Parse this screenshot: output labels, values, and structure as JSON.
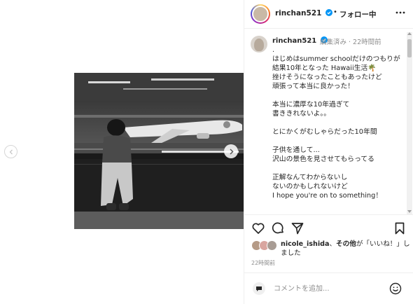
{
  "header": {
    "username": "rinchan521",
    "separator": "•",
    "follow_state": "フォロー中"
  },
  "caption": {
    "username": "rinchan521",
    "meta": "編集済み · 22時間前",
    "text": ".\nはじめはsummer schoolだけのつもりが\n結果10年となった Hawaii生活🌴\n挫けそうになったこともあったけど\n頑張って本当に良かった！\n\n本当に濃厚な10年過ぎて\n書ききれないよ。。\n\nとにかくがむしゃらだった10年間\n\n子供を通して...\n沢山の景色を見させてもらってる\n\n正解なんてわからないし\nないのかもしれないけど\nI hope you're on to something！"
  },
  "likes": {
    "user": "nicole_ishida",
    "connector": "、",
    "others": "その他",
    "suffix": "が「いいね！」しました"
  },
  "time_ago": "22時間前",
  "comment": {
    "placeholder": "コメントを追加..."
  },
  "icons": [
    "chevron-left-icon",
    "chevron-right-icon",
    "verified-badge-icon",
    "more-options-icon",
    "heart-icon",
    "comment-icon",
    "share-icon",
    "bookmark-icon",
    "emoji-icon"
  ],
  "colors": {
    "text": "#262626",
    "muted": "#8e8e8e",
    "verified": "#0095f6",
    "border": "#efefef"
  }
}
